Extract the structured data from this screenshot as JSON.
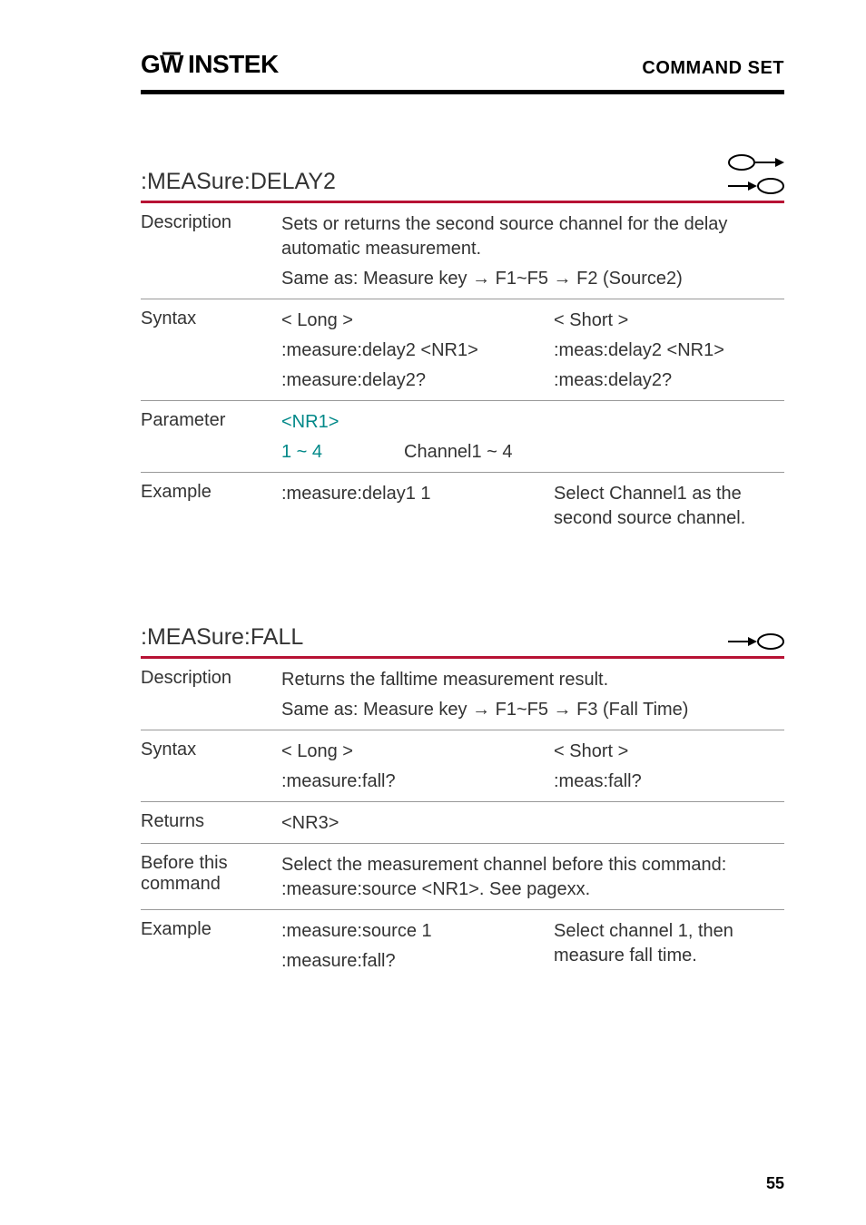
{
  "header": {
    "brand": "GWINSTEK",
    "section": "COMMAND SET"
  },
  "sections": [
    {
      "title": ":MEASure:DELAY2",
      "icons": [
        "set-query",
        "query-set"
      ],
      "rows": [
        {
          "label": "Description",
          "lines": [
            "Sets or returns the second source channel for the delay automatic measurement.",
            "Same as: Measure key → F1~F5 → F2 (Source2)"
          ]
        },
        {
          "label": "Syntax",
          "twocol": [
            [
              "< Long >",
              ":measure:delay2 <NR1>",
              ":measure:delay2?"
            ],
            [
              "< Short >",
              ":meas:delay2 <NR1>",
              ":meas:delay2?"
            ]
          ]
        },
        {
          "label": "Parameter",
          "param": {
            "head": "<NR1>",
            "row": [
              "1 ~ 4",
              "Channel1 ~ 4"
            ]
          }
        },
        {
          "label": "Example",
          "example": {
            "left": [
              ":measure:delay1 1"
            ],
            "right": "Select Channel1 as the second source channel."
          },
          "noborder": true
        }
      ]
    },
    {
      "title": ":MEASure:FALL",
      "icons": [
        "query-set"
      ],
      "rows": [
        {
          "label": "Description",
          "lines": [
            "Returns the falltime measurement result.",
            "Same as: Measure key → F1~F5 → F3 (Fall Time)"
          ]
        },
        {
          "label": "Syntax",
          "twocol": [
            [
              "< Long >",
              ":measure:fall?"
            ],
            [
              "< Short >",
              ":meas:fall?"
            ]
          ]
        },
        {
          "label": "Returns",
          "lines": [
            "<NR3>"
          ]
        },
        {
          "label": "Before this command",
          "lines": [
            "Select the measurement channel before this command: :measure:source <NR1>. See pagexx."
          ]
        },
        {
          "label": "Example",
          "example": {
            "left": [
              ":measure:source 1",
              ":measure:fall?"
            ],
            "right": "Select channel 1, then measure fall time."
          },
          "noborder": true
        }
      ]
    }
  ],
  "page_number": "55"
}
